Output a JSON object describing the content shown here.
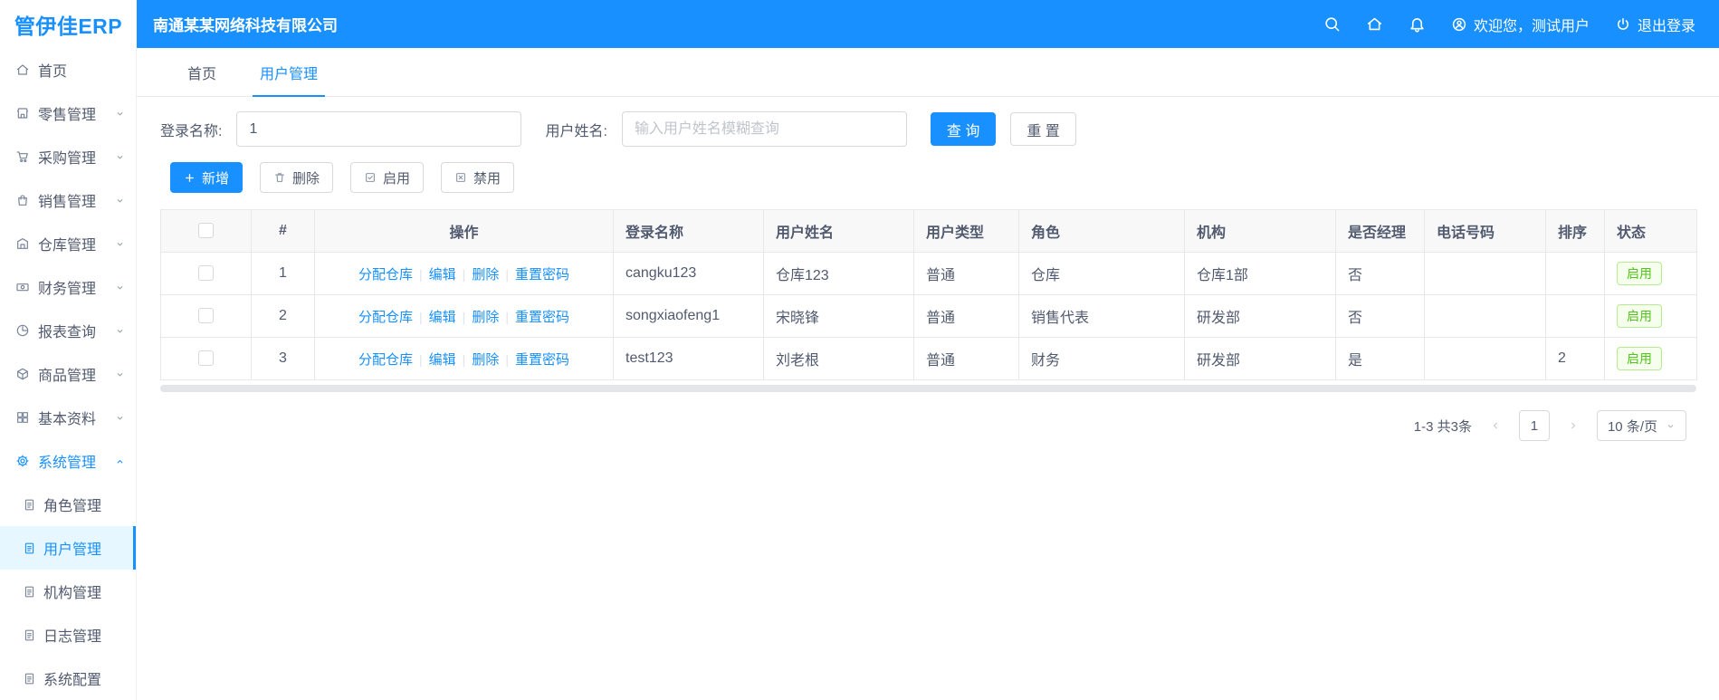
{
  "colors": {
    "primary": "#1890ff",
    "success": "#52c41a",
    "active_menu_bg": "#e6f7ff",
    "table_header_bg": "#f8f8f9"
  },
  "header": {
    "logo": "管伊佳ERP",
    "company": "南通某某网络科技有限公司",
    "welcome": "欢迎您，测试用户",
    "logout": "退出登录"
  },
  "sidebar": {
    "items": [
      {
        "label": "首页",
        "icon": "home-icon",
        "expandable": false
      },
      {
        "label": "零售管理",
        "icon": "retail-icon",
        "expandable": true
      },
      {
        "label": "采购管理",
        "icon": "purchase-icon",
        "expandable": true
      },
      {
        "label": "销售管理",
        "icon": "sales-icon",
        "expandable": true
      },
      {
        "label": "仓库管理",
        "icon": "warehouse-icon",
        "expandable": true
      },
      {
        "label": "财务管理",
        "icon": "finance-icon",
        "expandable": true
      },
      {
        "label": "报表查询",
        "icon": "report-icon",
        "expandable": true
      },
      {
        "label": "商品管理",
        "icon": "goods-icon",
        "expandable": true
      },
      {
        "label": "基本资料",
        "icon": "basic-data-icon",
        "expandable": true
      },
      {
        "label": "系统管理",
        "icon": "system-icon",
        "expandable": true,
        "expanded": true
      }
    ],
    "system_children": [
      {
        "label": "角色管理",
        "active": false
      },
      {
        "label": "用户管理",
        "active": true
      },
      {
        "label": "机构管理",
        "active": false
      },
      {
        "label": "日志管理",
        "active": false
      },
      {
        "label": "系统配置",
        "active": false
      }
    ]
  },
  "tabs": [
    {
      "label": "首页",
      "active": false
    },
    {
      "label": "用户管理",
      "active": true
    }
  ],
  "search": {
    "login_label": "登录名称:",
    "login_value": "1",
    "name_label": "用户姓名:",
    "name_placeholder": "输入用户姓名模糊查询",
    "query_button": "查 询",
    "reset_button": "重 置"
  },
  "toolbar": {
    "add": "新增",
    "delete": "删除",
    "enable": "启用",
    "disable": "禁用"
  },
  "table": {
    "headers": [
      "#",
      "操作",
      "登录名称",
      "用户姓名",
      "用户类型",
      "角色",
      "机构",
      "是否经理",
      "电话号码",
      "排序",
      "状态"
    ],
    "op_links": [
      "分配仓库",
      "编辑",
      "删除",
      "重置密码"
    ],
    "rows": [
      {
        "index": "1",
        "login": "cangku123",
        "name": "仓库123",
        "type": "普通",
        "role": "仓库",
        "org": "仓库1部",
        "manager": "否",
        "phone": "",
        "sort": "",
        "status": "启用"
      },
      {
        "index": "2",
        "login": "songxiaofeng1",
        "name": "宋晓锋",
        "type": "普通",
        "role": "销售代表",
        "org": "研发部",
        "manager": "否",
        "phone": "",
        "sort": "",
        "status": "启用"
      },
      {
        "index": "3",
        "login": "test123",
        "name": "刘老根",
        "type": "普通",
        "role": "财务",
        "org": "研发部",
        "manager": "是",
        "phone": "",
        "sort": "2",
        "status": "启用"
      }
    ]
  },
  "pagination": {
    "total": "1-3 共3条",
    "current_page": "1",
    "page_size": "10 条/页"
  }
}
